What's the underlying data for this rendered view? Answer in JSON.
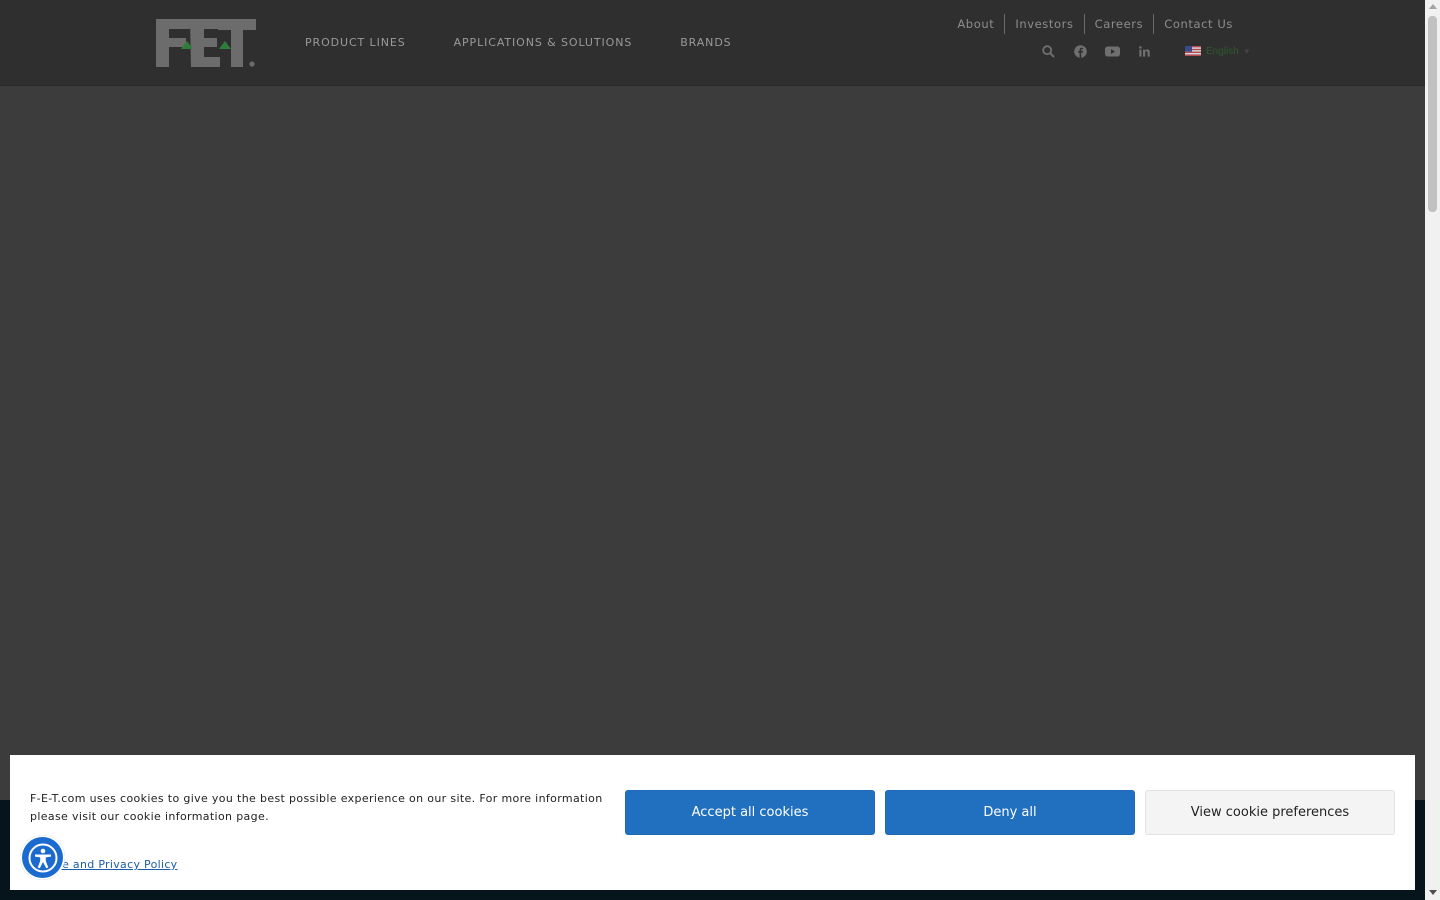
{
  "header": {
    "logo_text": "FET",
    "nav": [
      {
        "label": "PRODUCT LINES"
      },
      {
        "label": "APPLICATIONS & SOLUTIONS"
      },
      {
        "label": "BRANDS"
      }
    ],
    "top_links": [
      {
        "label": "About"
      },
      {
        "label": "Investors"
      },
      {
        "label": "Careers"
      },
      {
        "label": "Contact Us"
      }
    ],
    "icons": [
      "search-icon",
      "facebook-icon",
      "youtube-icon",
      "linkedin-icon"
    ],
    "language": {
      "label": "English",
      "flag": "us-flag-icon"
    }
  },
  "cookie_banner": {
    "message": "F-E-T.com uses cookies to give you the best possible experience on our site. For more information please visit our cookie information page.",
    "policy_link": "Cookie and Privacy Policy",
    "accept_label": "Accept all cookies",
    "deny_label": "Deny all",
    "preferences_label": "View cookie preferences"
  },
  "accessibility": {
    "icon": "accessibility-icon"
  },
  "colors": {
    "header_bg": "#2f2f2f",
    "overlay_bg": "#3c3c3c",
    "primary_button": "#2170bf",
    "footer_bg": "#06141b",
    "logo_green": "#3f9b4c"
  }
}
